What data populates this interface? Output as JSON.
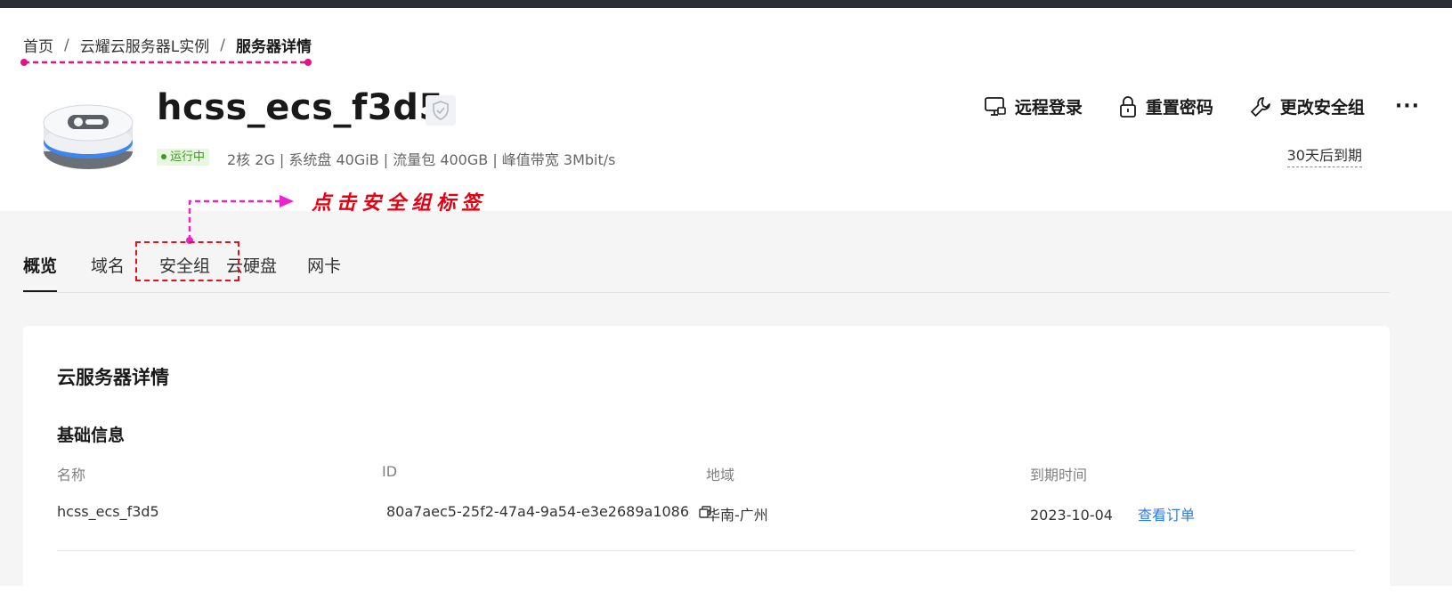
{
  "breadcrumb": {
    "home": "首页",
    "instances": "云耀云服务器L实例",
    "current": "服务器详情",
    "separator": "/"
  },
  "server": {
    "name": "hcss_ecs_f3d5",
    "status": "运行中",
    "spec": "2核  2G | 系统盘 40GiB | 流量包 400GB | 峰值带宽 3Mbit/s",
    "expire": "30天后到期"
  },
  "actions": {
    "remote_login": "远程登录",
    "reset_password": "重置密码",
    "change_security_group": "更改安全组",
    "more": "···"
  },
  "annotation": {
    "text": "点击安全组标签",
    "color": "#e60012"
  },
  "tabs": [
    {
      "label": "概览",
      "active": true
    },
    {
      "label": "域名"
    },
    {
      "label": "安全组"
    },
    {
      "label": "云硬盘"
    },
    {
      "label": "网卡"
    }
  ],
  "details": {
    "title": "云服务器详情",
    "section": "基础信息",
    "columns": {
      "name": "名称",
      "id": "ID",
      "region": "地域",
      "expire_time": "到期时间"
    },
    "values": {
      "name": "hcss_ecs_f3d5",
      "id": "80a7aec5-25f2-47a4-9a54-e3e2689a1086",
      "region": "华南-广州",
      "expire_time": "2023-10-04",
      "order_link": "查看订单"
    }
  },
  "colors": {
    "status_green": "#3a9c16",
    "link_blue": "#2e7be8",
    "annotation_magenta": "#e6127e"
  }
}
